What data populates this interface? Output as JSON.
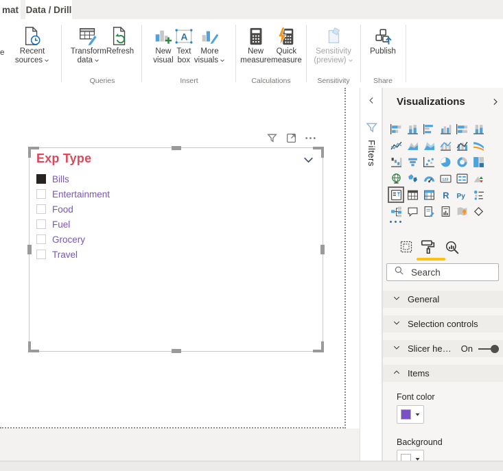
{
  "window": {
    "tabs": [
      {
        "label": "mat",
        "active": true
      },
      {
        "label": "Data / Drill",
        "active": true
      }
    ]
  },
  "ribbon": {
    "clipped_button_label": "e",
    "groups": [
      {
        "label": "",
        "buttons": [
          {
            "label1": "Recent",
            "label2": "sources",
            "chevron": true,
            "icon": "recent-sources",
            "disabled": false
          }
        ]
      },
      {
        "label": "Queries",
        "buttons": [
          {
            "label1": "Transform",
            "label2": "data",
            "chevron": true,
            "icon": "transform-data",
            "disabled": false
          },
          {
            "label1": "Refresh",
            "label2": "",
            "chevron": false,
            "icon": "refresh",
            "disabled": false
          }
        ]
      },
      {
        "label": "Insert",
        "buttons": [
          {
            "label1": "New",
            "label2": "visual",
            "chevron": false,
            "icon": "new-visual",
            "disabled": false
          },
          {
            "label1": "Text",
            "label2": "box",
            "chevron": false,
            "icon": "text-box",
            "disabled": false
          },
          {
            "label1": "More",
            "label2": "visuals",
            "chevron": true,
            "icon": "more-visuals",
            "disabled": false
          }
        ]
      },
      {
        "label": "Calculations",
        "buttons": [
          {
            "label1": "New",
            "label2": "measure",
            "chevron": false,
            "icon": "new-measure",
            "disabled": false
          },
          {
            "label1": "Quick",
            "label2": "measure",
            "chevron": false,
            "icon": "quick-measure",
            "disabled": false
          }
        ]
      },
      {
        "label": "Sensitivity",
        "buttons": [
          {
            "label1": "Sensitivity",
            "label2": "(preview)",
            "chevron": true,
            "icon": "sensitivity",
            "disabled": true
          }
        ]
      },
      {
        "label": "Share",
        "buttons": [
          {
            "label1": "Publish",
            "label2": "",
            "chevron": false,
            "icon": "publish",
            "disabled": false
          }
        ]
      }
    ]
  },
  "canvas": {
    "visual_toolbar_icons": [
      "filter",
      "focus-mode",
      "more-options"
    ],
    "slicer": {
      "title": "Exp Type",
      "items": [
        {
          "label": "Bills",
          "checked": true
        },
        {
          "label": "Entertainment",
          "checked": false
        },
        {
          "label": "Food",
          "checked": false
        },
        {
          "label": "Fuel",
          "checked": false
        },
        {
          "label": "Grocery",
          "checked": false
        },
        {
          "label": "Travel",
          "checked": false
        }
      ]
    }
  },
  "filters_panel": {
    "label": "Filters"
  },
  "viz_pane": {
    "title": "Visualizations",
    "icons": [
      "stacked-bar-chart",
      "stacked-column-chart",
      "clustered-bar-chart",
      "clustered-column-chart",
      "100-stacked-bar-chart",
      "100-stacked-column-chart",
      "line-chart",
      "area-chart",
      "stacked-area-chart",
      "line-stacked-column-chart",
      "line-clustered-column-chart",
      "ribbon-chart",
      "waterfall-chart",
      "funnel-chart",
      "scatter-chart",
      "pie-chart",
      "donut-chart",
      "treemap",
      "map",
      "filled-map",
      "gauge",
      "card",
      "multi-row-card",
      "kpi",
      "slicer",
      "table",
      "matrix",
      "r-script",
      "python-script",
      "key-influencers",
      "decomposition-tree",
      "q-and-a",
      "smart-narrative",
      "paginated-report",
      "arcgis-map",
      "power-apps"
    ],
    "selected_icon": "slicer",
    "tabs": [
      "fields",
      "format",
      "analytics"
    ],
    "active_tab": "format",
    "search_placeholder": "Search",
    "sections": [
      {
        "label": "General",
        "expanded": false
      },
      {
        "label": "Selection controls",
        "expanded": false
      },
      {
        "label": "Slicer he…",
        "expanded": false,
        "toggle": {
          "label": "On",
          "on": true
        }
      },
      {
        "label": "Items",
        "expanded": true
      }
    ],
    "items_card": {
      "fields": [
        {
          "label": "Font color",
          "swatch": "#7B4FC6"
        },
        {
          "label": "Background",
          "swatch": "#FFFFFF"
        }
      ]
    }
  },
  "colors": {
    "slicer_title_red": "#E0485A",
    "slicer_item_purple": "#7B52C3",
    "checkbox_checked": "#252423",
    "tab_underline_yellow": "#FFC20E",
    "icon_blue": "#4FA3DC"
  }
}
